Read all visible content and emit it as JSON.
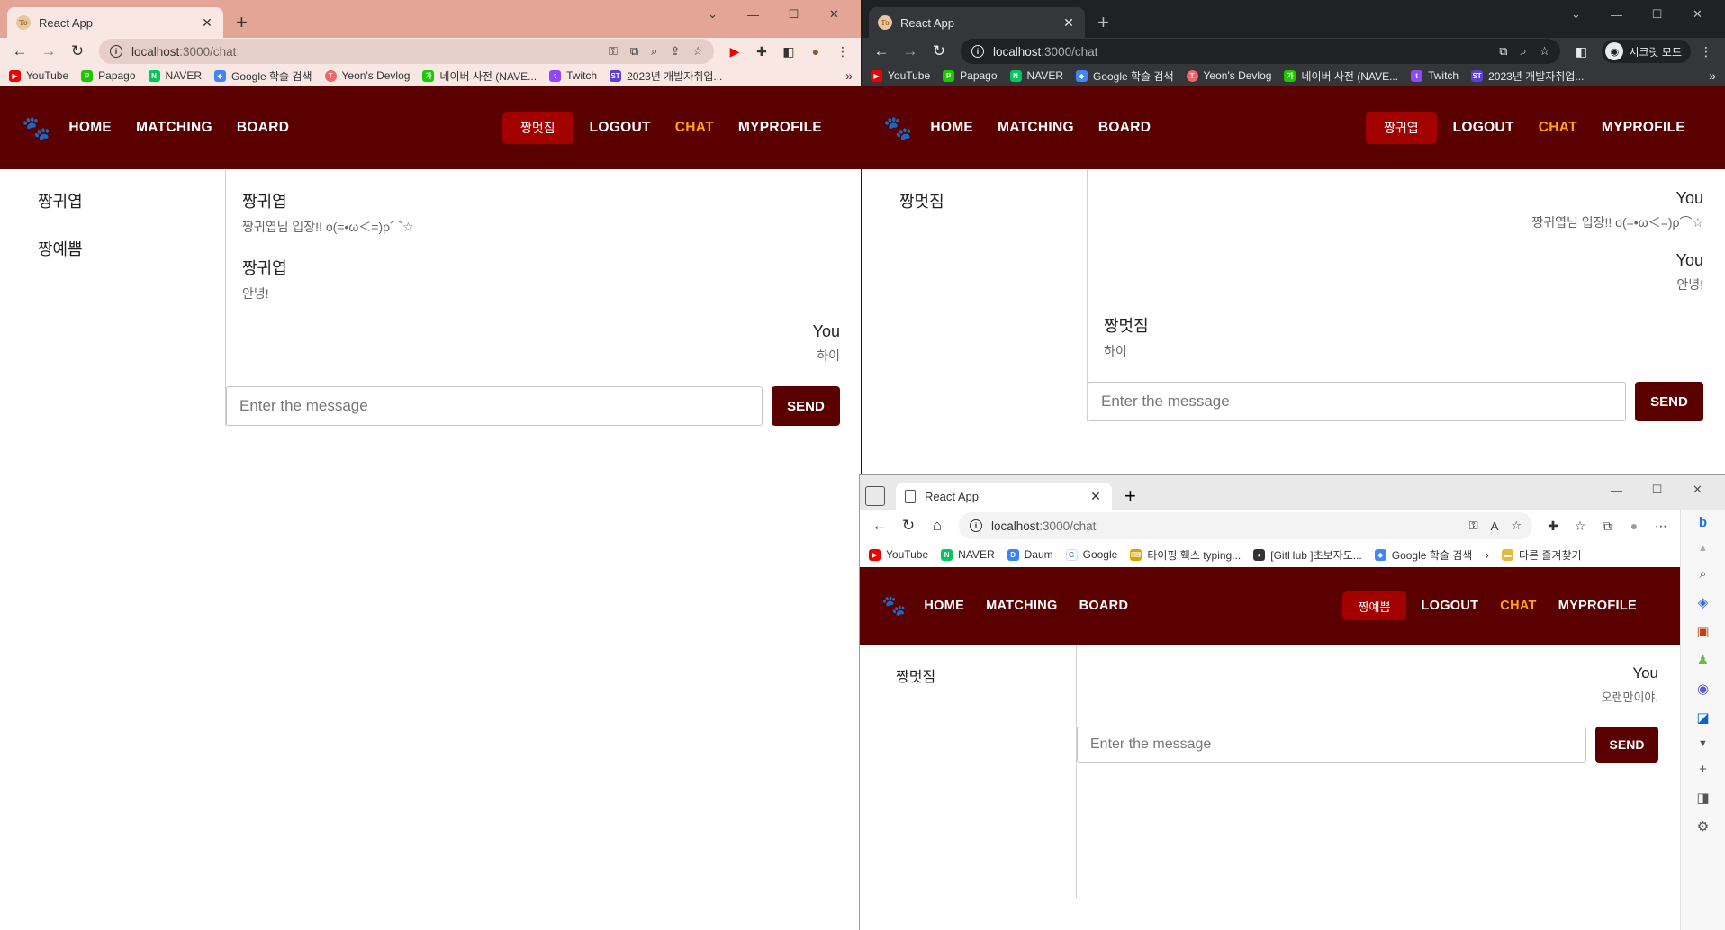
{
  "windows": {
    "w1": {
      "tab_title": "React App",
      "favicon": "To",
      "url_host": "localhost",
      "url_path": ":3000/chat",
      "bookmarks": [
        "YouTube",
        "Papago",
        "NAVER",
        "Google 학술 검색",
        "Yeon's Devlog",
        "네이버 사전 (NAVE...",
        "Twitch",
        "2023년 개발자취업..."
      ],
      "nickname": "짱멋짐",
      "rooms": [
        "짱귀엽",
        "짱예쁨"
      ],
      "messages": [
        {
          "who": "짱귀엽",
          "text": "짱귀엽님 입장!! o(=•ω＜=)ρ⌒☆"
        },
        {
          "who": "짱귀엽",
          "text": "안녕!"
        },
        {
          "who": "You",
          "text": "하이"
        }
      ]
    },
    "w2": {
      "tab_title": "React App",
      "favicon": "To",
      "url_host": "localhost",
      "url_path": ":3000/chat",
      "incognito_label": "시크릿 모드",
      "bookmarks": [
        "YouTube",
        "Papago",
        "NAVER",
        "Google 학술 검색",
        "Yeon's Devlog",
        "네이버 사전 (NAVE...",
        "Twitch",
        "2023년 개발자취업..."
      ],
      "nickname": "짱귀엽",
      "rooms": [
        "짱멋짐"
      ],
      "messages": [
        {
          "who": "You",
          "text": "짱귀엽님 입장!! o(=•ω＜=)ρ⌒☆"
        },
        {
          "who": "You",
          "text": "안녕!"
        },
        {
          "who": "짱멋짐",
          "text": "하이"
        }
      ]
    },
    "w3": {
      "tab_title": "React App",
      "url_host": "localhost",
      "url_path": ":3000/chat",
      "bookmarks": [
        "YouTube",
        "NAVER",
        "Daum",
        "Google",
        "타이핑 훽스 typing...",
        "[GitHub ]초보자도...",
        "Google 학술 검색"
      ],
      "favorites_label": "다른 즐겨찾기",
      "nickname": "짱예쁨",
      "rooms": [
        "짱멋짐"
      ],
      "messages": [
        {
          "who": "You",
          "text": "오랜만이야."
        }
      ]
    }
  },
  "nav": {
    "home": "HOME",
    "matching": "MATCHING",
    "board": "BOARD",
    "logout": "LOGOUT",
    "chat": "CHAT",
    "myprofile": "MYPROFILE"
  },
  "composer": {
    "placeholder": "Enter the message",
    "send": "SEND"
  },
  "colors": {
    "nav_bg": "#5a0000",
    "nickname_bg": "#a30000",
    "active_link": "#ffa412",
    "send_bg": "#5a0000"
  },
  "icons": {
    "logo": "paw-icon"
  }
}
